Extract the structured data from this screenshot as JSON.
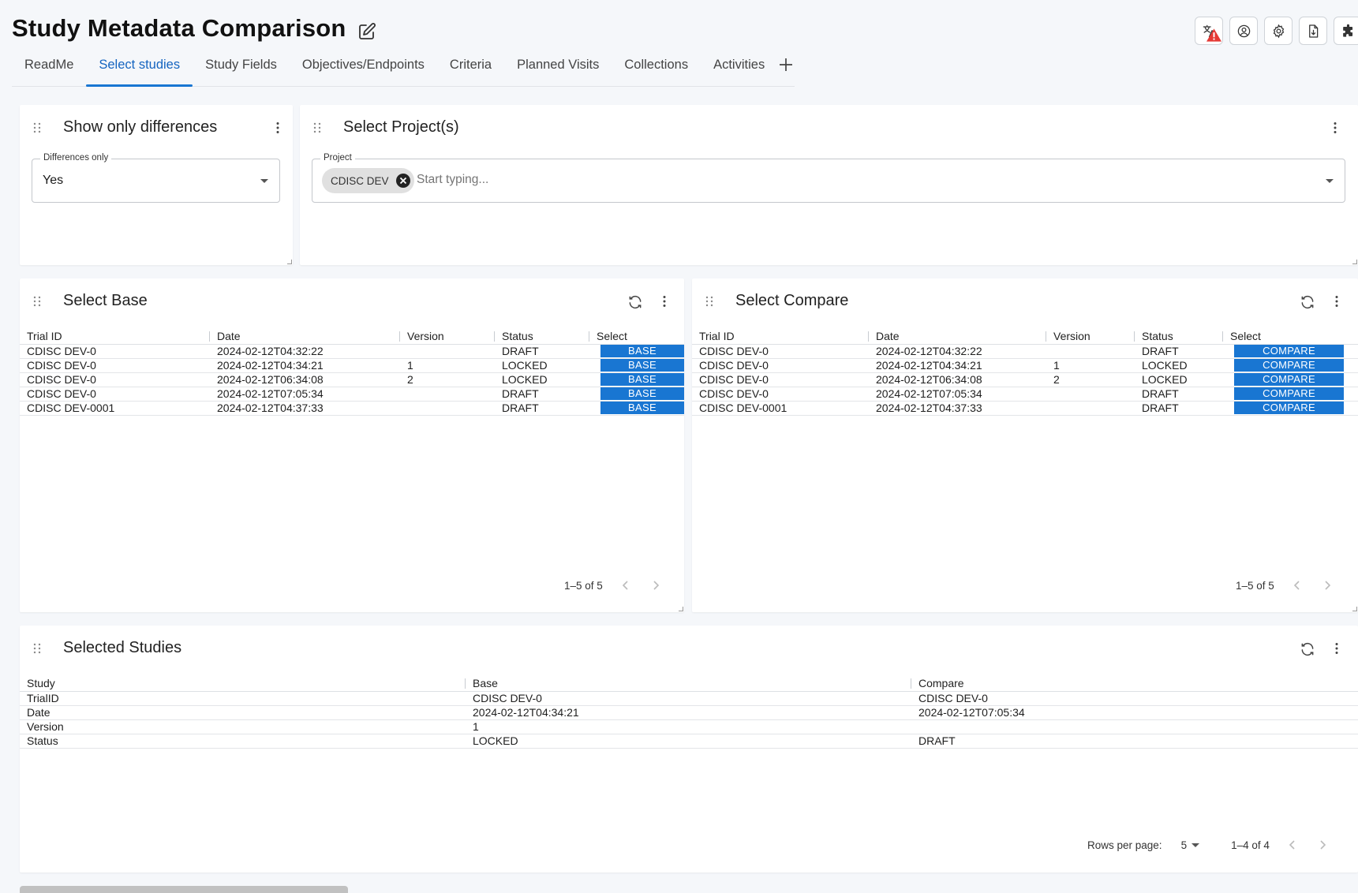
{
  "app": {
    "title": "Study Metadata Comparison"
  },
  "top_icons": [
    "translate-icon",
    "account-circle-icon",
    "gear-icon",
    "file-export-icon",
    "puzzle-icon"
  ],
  "tabs": [
    {
      "label": "ReadMe",
      "active": false
    },
    {
      "label": "Select studies",
      "active": true
    },
    {
      "label": "Study Fields",
      "active": false
    },
    {
      "label": "Objectives/Endpoints",
      "active": false
    },
    {
      "label": "Criteria",
      "active": false
    },
    {
      "label": "Planned Visits",
      "active": false
    },
    {
      "label": "Collections",
      "active": false
    },
    {
      "label": "Activities",
      "active": false
    }
  ],
  "differences_card": {
    "title": "Show only differences",
    "field_label": "Differences only",
    "value": "Yes"
  },
  "projects_card": {
    "title": "Select Project(s)",
    "field_label": "Project",
    "chip": "CDISC DEV",
    "placeholder": "Start typing..."
  },
  "base_card": {
    "title": "Select Base",
    "columns": [
      "Trial ID",
      "Date",
      "Version",
      "Status",
      "Select"
    ],
    "rows": [
      {
        "trial_id": "CDISC DEV-0",
        "date": "2024-02-12T04:32:22",
        "version": "",
        "status": "DRAFT",
        "action": "BASE"
      },
      {
        "trial_id": "CDISC DEV-0",
        "date": "2024-02-12T04:34:21",
        "version": "1",
        "status": "LOCKED",
        "action": "BASE"
      },
      {
        "trial_id": "CDISC DEV-0",
        "date": "2024-02-12T06:34:08",
        "version": "2",
        "status": "LOCKED",
        "action": "BASE"
      },
      {
        "trial_id": "CDISC DEV-0",
        "date": "2024-02-12T07:05:34",
        "version": "",
        "status": "DRAFT",
        "action": "BASE"
      },
      {
        "trial_id": "CDISC DEV-0001",
        "date": "2024-02-12T04:37:33",
        "version": "",
        "status": "DRAFT",
        "action": "BASE"
      }
    ],
    "pagination": "1–5 of 5"
  },
  "compare_card": {
    "title": "Select Compare",
    "columns": [
      "Trial ID",
      "Date",
      "Version",
      "Status",
      "Select"
    ],
    "rows": [
      {
        "trial_id": "CDISC DEV-0",
        "date": "2024-02-12T04:32:22",
        "version": "",
        "status": "DRAFT",
        "action": "COMPARE"
      },
      {
        "trial_id": "CDISC DEV-0",
        "date": "2024-02-12T04:34:21",
        "version": "1",
        "status": "LOCKED",
        "action": "COMPARE"
      },
      {
        "trial_id": "CDISC DEV-0",
        "date": "2024-02-12T06:34:08",
        "version": "2",
        "status": "LOCKED",
        "action": "COMPARE"
      },
      {
        "trial_id": "CDISC DEV-0",
        "date": "2024-02-12T07:05:34",
        "version": "",
        "status": "DRAFT",
        "action": "COMPARE"
      },
      {
        "trial_id": "CDISC DEV-0001",
        "date": "2024-02-12T04:37:33",
        "version": "",
        "status": "DRAFT",
        "action": "COMPARE"
      }
    ],
    "pagination": "1–5 of 5"
  },
  "selected_card": {
    "title": "Selected Studies",
    "columns": [
      "Study",
      "Base",
      "Compare"
    ],
    "rows": [
      {
        "study": "TrialID",
        "base": "CDISC DEV-0",
        "compare": "CDISC DEV-0"
      },
      {
        "study": "Date",
        "base": "2024-02-12T04:34:21",
        "compare": "2024-02-12T07:05:34"
      },
      {
        "study": "Version",
        "base": "1",
        "compare": ""
      },
      {
        "study": "Status",
        "base": "LOCKED",
        "compare": "DRAFT"
      }
    ],
    "rows_per_page_label": "Rows per page:",
    "rows_per_page": "5",
    "pagination": "1–4 of 4"
  },
  "colors": {
    "accent": "#1976d2",
    "warning": "#e53935"
  }
}
